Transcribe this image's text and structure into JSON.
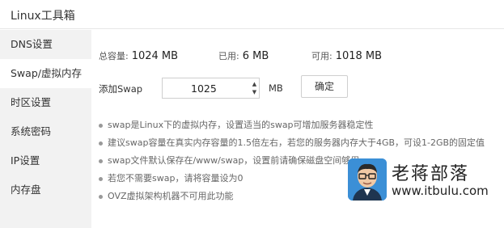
{
  "window": {
    "title": "Linux工具箱"
  },
  "sidebar": {
    "items": [
      {
        "label": "DNS设置"
      },
      {
        "label": "Swap/虚拟内存"
      },
      {
        "label": "时区设置"
      },
      {
        "label": "系统密码"
      },
      {
        "label": "IP设置"
      },
      {
        "label": "内存盘"
      }
    ],
    "active_index": 1
  },
  "stats": {
    "total_label": "总容量:",
    "total_value": "1024 MB",
    "used_label": "已用:",
    "used_value": "6 MB",
    "available_label": "可用:",
    "available_value": "1018 MB"
  },
  "add_swap": {
    "label": "添加Swap",
    "value": "1025",
    "unit": "MB",
    "confirm_label": "确定"
  },
  "notes": [
    "swap是Linux下的虚拟内存，设置适当的swap可增加服务器稳定性",
    "建议swap容量在真实内存容量的1.5倍左右，若您的服务器内存大于4GB，可设1-2GB的固定值",
    "swap文件默认保存在/www/swap，设置前请确保磁盘空间够用",
    "若您不需要swap，请将容量设为0",
    "OVZ虚拟架构机器不可用此功能"
  ],
  "watermark": {
    "brand": "老蒋部落",
    "url": "www.itbulu.com"
  },
  "colors": {
    "sidebar_bg": "#f2f2f2",
    "active_bg": "#ffffff",
    "border": "#cfcfcf",
    "bullet": "#999999"
  }
}
